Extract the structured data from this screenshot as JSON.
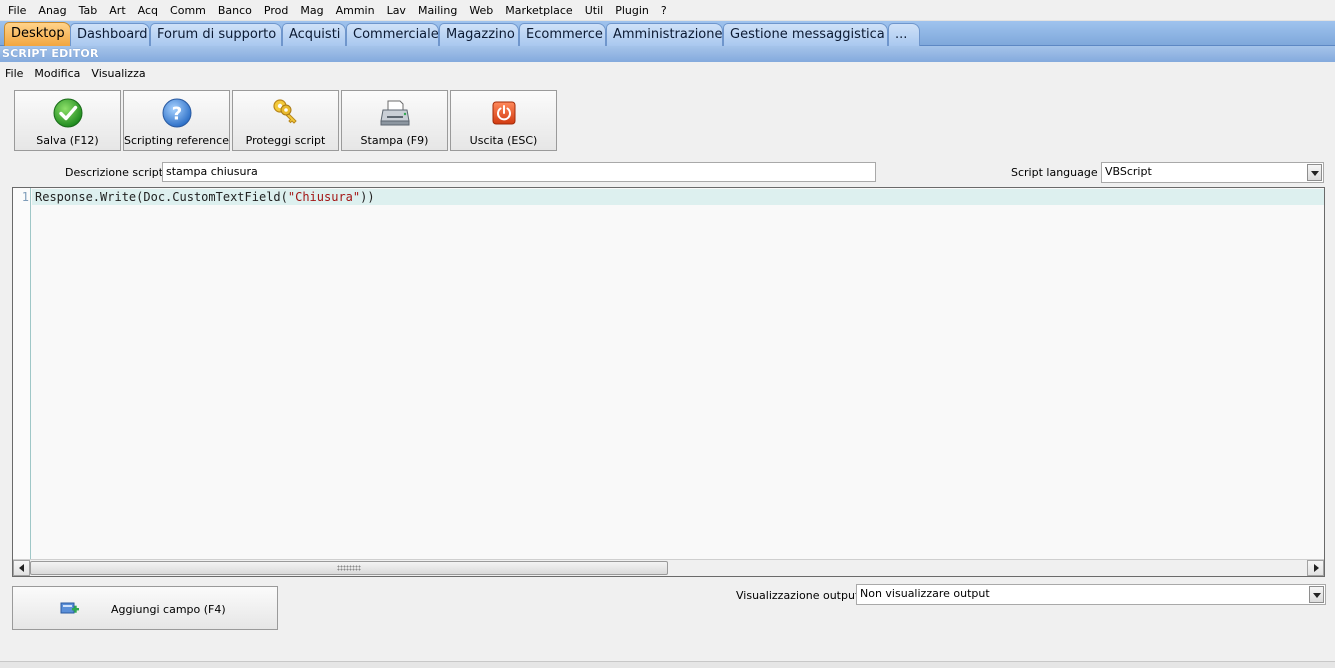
{
  "menubar": {
    "items": [
      {
        "label": "File"
      },
      {
        "label": "Anag"
      },
      {
        "label": "Tab"
      },
      {
        "label": "Art"
      },
      {
        "label": "Acq"
      },
      {
        "label": "Comm"
      },
      {
        "label": "Banco"
      },
      {
        "label": "Prod"
      },
      {
        "label": "Mag"
      },
      {
        "label": "Ammin"
      },
      {
        "label": "Lav"
      },
      {
        "label": "Mailing"
      },
      {
        "label": "Web"
      },
      {
        "label": "Marketplace"
      },
      {
        "label": "Util"
      },
      {
        "label": "Plugin"
      },
      {
        "label": "?"
      }
    ]
  },
  "tabs": [
    {
      "label": "Desktop",
      "active": true
    },
    {
      "label": "Dashboard"
    },
    {
      "label": "Forum di supporto"
    },
    {
      "label": "Acquisti"
    },
    {
      "label": "Commerciale"
    },
    {
      "label": "Magazzino"
    },
    {
      "label": "Ecommerce"
    },
    {
      "label": "Amministrazione"
    },
    {
      "label": "Gestione messaggistica"
    },
    {
      "label": "..."
    }
  ],
  "window": {
    "title": "SCRIPT EDITOR"
  },
  "submenu": {
    "items": [
      {
        "label": "File"
      },
      {
        "label": "Modifica"
      },
      {
        "label": "Visualizza"
      }
    ]
  },
  "toolbar": {
    "buttons": [
      {
        "label": "Salva (F12)",
        "icon": "check-icon"
      },
      {
        "label": "Scripting reference",
        "icon": "help-icon"
      },
      {
        "label": "Proteggi script",
        "icon": "keys-icon"
      },
      {
        "label": "Stampa (F9)",
        "icon": "printer-icon"
      },
      {
        "label": "Uscita (ESC)",
        "icon": "power-icon"
      }
    ]
  },
  "form": {
    "description_label": "Descrizione script :",
    "description_value": "stampa chiusura",
    "language_label": "Script language :",
    "language_value": "VBScript",
    "output_label": "Visualizzazione output :",
    "output_value": "Non visualizzare output"
  },
  "editor": {
    "line_number": "1",
    "code_before": "Response.Write(Doc.CustomTextField(",
    "code_string": "\"Chiusura\"",
    "code_after": "))"
  },
  "add_field_button": {
    "label": "Aggiungi campo (F4)",
    "icon": "add-field-icon"
  },
  "colors": {
    "accent_tab": "#f2a640",
    "tabstrip": "#7fa8db",
    "string_literal": "#a31515"
  }
}
